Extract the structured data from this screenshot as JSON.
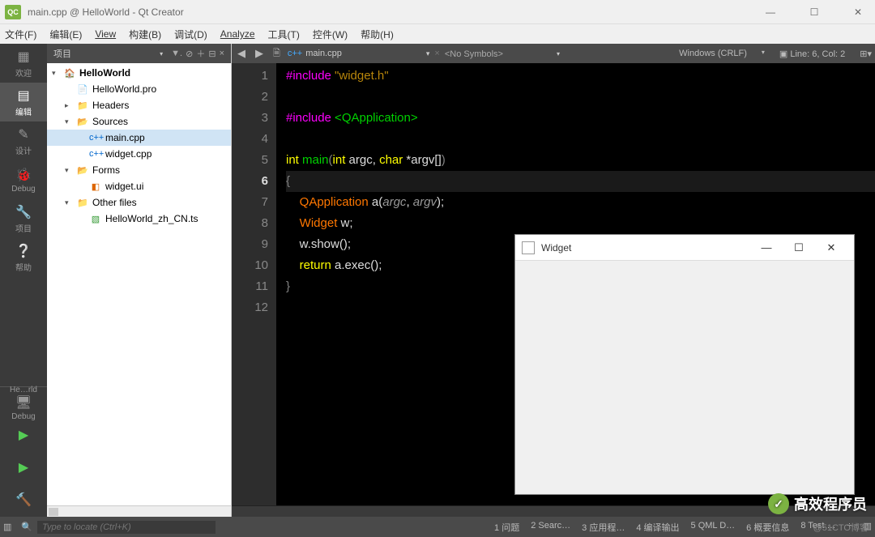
{
  "window": {
    "title": "main.cpp @ HelloWorld - Qt Creator"
  },
  "menu": {
    "file": "文件(F)",
    "edit": "编辑(E)",
    "view": "View",
    "build": "构建(B)",
    "debug": "调试(D)",
    "analyze": "Analyze",
    "tools": "工具(T)",
    "widgets": "控件(W)",
    "help": "帮助(H)"
  },
  "sidebar": {
    "welcome": "欢迎",
    "edit": "编辑",
    "design": "设计",
    "debug": "Debug",
    "projects": "项目",
    "help": "帮助",
    "kit": "He…rld",
    "debug2": "Debug"
  },
  "project_panel": {
    "title": "项目",
    "tree": {
      "root": "HelloWorld",
      "pro": "HelloWorld.pro",
      "headers": "Headers",
      "sources": "Sources",
      "main": "main.cpp",
      "widget": "widget.cpp",
      "forms": "Forms",
      "widgetui": "widget.ui",
      "other": "Other files",
      "ts": "HelloWorld_zh_CN.ts"
    }
  },
  "editor": {
    "file": "main.cpp",
    "symbols": "<No Symbols>",
    "encoding": "Windows (CRLF)",
    "position": "Line: 6, Col: 2",
    "gutter": [
      "1",
      "2",
      "3",
      "4",
      "5",
      "6",
      "7",
      "8",
      "9",
      "10",
      "11",
      "12"
    ],
    "current_line": 6
  },
  "code": {
    "l1_inc": "#include",
    "l1_str": " \"widget.h\"",
    "l3_inc": "#include",
    "l3_lib": " <QApplication>",
    "l5_int": "int",
    "l5_main": " main",
    "l5_p1": "(",
    "l5_intarg": "int",
    "l5_argc": " argc, ",
    "l5_char": "char",
    "l5_argv": " *argv[]",
    "l5_p2": ")",
    "l6_brace": "{",
    "l7_indent": "    ",
    "l7_qapp": "QApplication",
    "l7_a": " a(",
    "l7_argc": "argc",
    "l7_comma": ", ",
    "l7_argv": "argv",
    "l7_end": ");",
    "l8_indent": "    ",
    "l8_widget": "Widget",
    "l8_w": " w;",
    "l9": "    w.show();",
    "l10_indent": "    ",
    "l10_ret": "return",
    "l10_exec": " a.exec();",
    "l11": "}"
  },
  "status": {
    "locator_placeholder": "Type to locate (Ctrl+K)",
    "t1": "1 问题",
    "t2": "2 Searc…",
    "t3": "3 应用程…",
    "t4": "4 编译输出",
    "t5": "5 QML D…",
    "t6": "6 概要信息",
    "t8": "8 Test …"
  },
  "widget_window": {
    "title": "Widget"
  },
  "watermark": {
    "text": "高效程序员",
    "sub": "@51CTO博客"
  }
}
